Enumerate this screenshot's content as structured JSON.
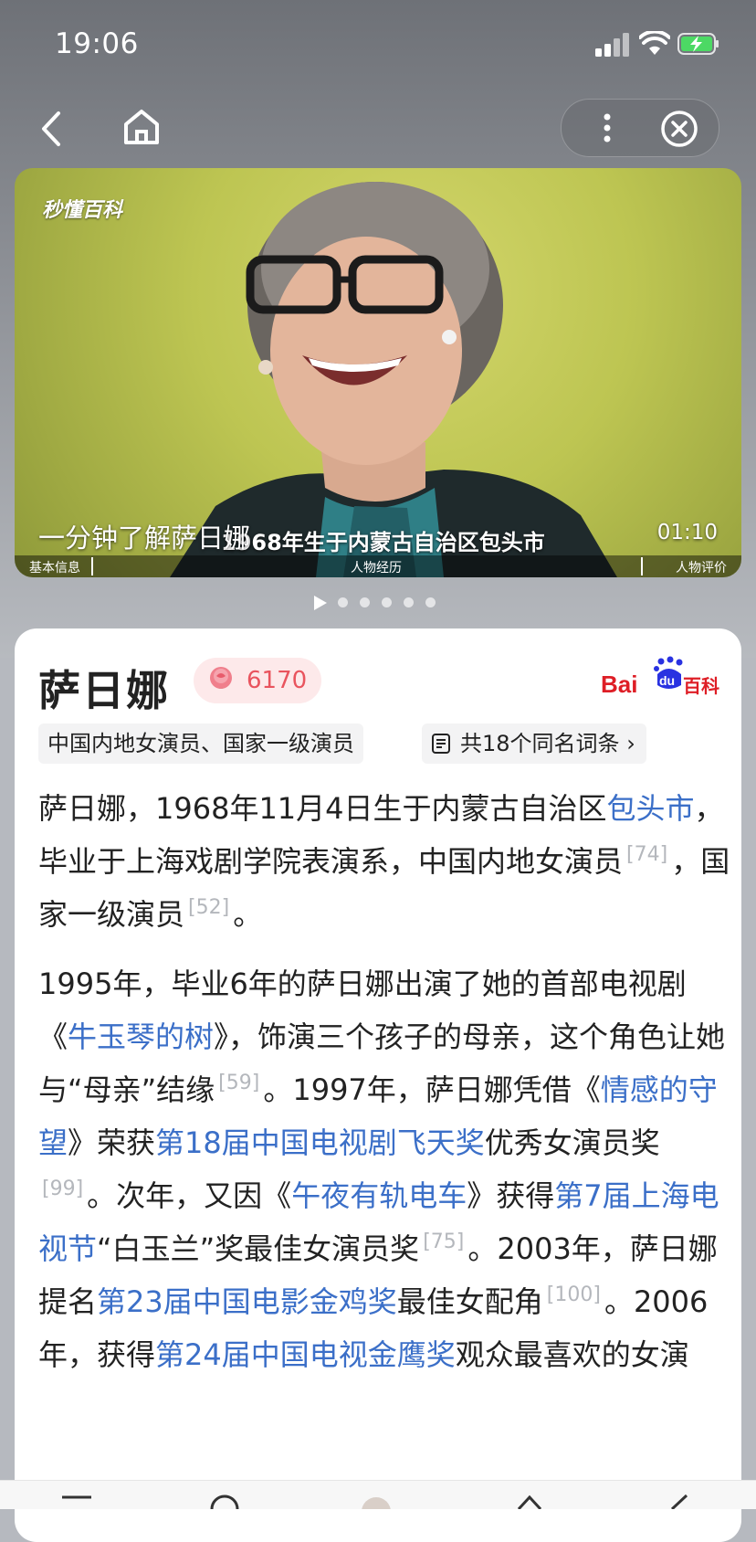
{
  "status_bar": {
    "time": "19:06"
  },
  "nav": {
    "back_icon": "chevron-left-icon",
    "home_icon": "home-icon",
    "more_icon": "more-vertical-icon",
    "close_icon": "close-circle-icon"
  },
  "video": {
    "watermark": "秒懂百科",
    "title": "一分钟了解萨日娜",
    "caption": "1968年生于内蒙古自治区包头市",
    "duration": "01:10",
    "chapters": [
      "基本信息",
      "人物经历",
      "人物评价"
    ],
    "pager_count": 6,
    "pager_active_index": 0
  },
  "entry": {
    "name": "萨日娜",
    "flower_count": "6170",
    "brand": {
      "bai": "Bai",
      "du": "du",
      "baike": "百科"
    },
    "tags": [
      "中国内地女演员、国家一级演员"
    ],
    "same_name": "共18个同名词条",
    "paragraph1": {
      "t1": "萨日娜，1968年11月4日生于内蒙古自治区",
      "l1": "包头市",
      "t2": "，毕业于上海戏剧学院表演系，中国内地女演员",
      "r1": "[74]",
      "t3": "，国家一级演员",
      "r2": "[52]",
      "t4": "。"
    },
    "paragraph2": {
      "t1": "1995年，毕业6年的萨日娜出演了她的首部电视剧《",
      "l1": "牛玉琴的树",
      "t2": "》，饰演三个孩子的母亲，这个角色让她与“母亲”结缘",
      "r1": "[59]",
      "t3": "。1997年，萨日娜凭借《",
      "l2": "情感的守望",
      "t4": "》荣获",
      "l3": "第18届中国电视剧飞天奖",
      "t5": "优秀女演员奖",
      "r2": "[99]",
      "t6": "。次年，又因《",
      "l4": "午夜有轨电车",
      "t7": "》获得",
      "l5": "第7届上海电视节",
      "t8": "“白玉兰”奖最佳女演员奖",
      "r3": "[75]",
      "t9": "。2003年，萨日娜提名",
      "l6": "第23届中国电影金鸡奖",
      "t10": "最佳女配角",
      "r4": "[100]",
      "t11": "。2006年，获得",
      "l7": "第24届中国电视金鹰奖",
      "t12": "观众最喜欢的女演"
    }
  },
  "colors": {
    "link": "#3b6fc8",
    "flower": "#e9545e",
    "baidu_red": "#de1e26",
    "baidu_blue": "#2932e1"
  }
}
